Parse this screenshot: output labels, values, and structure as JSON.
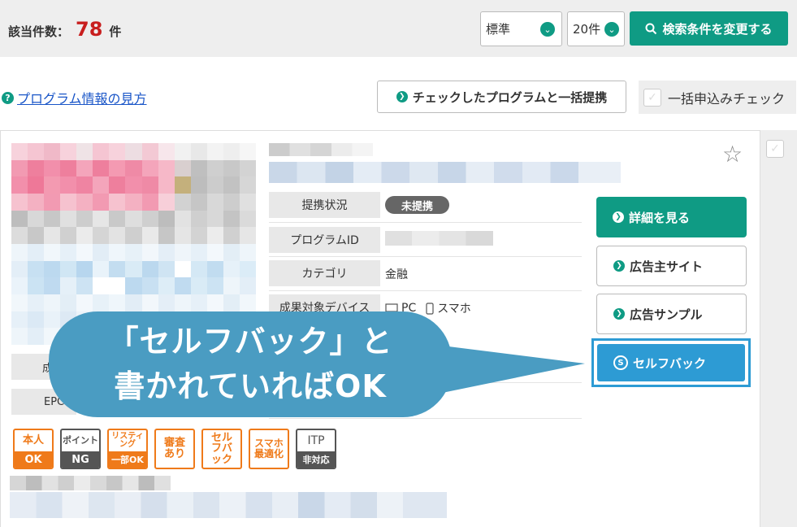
{
  "results": {
    "prefix": "該当件数：",
    "count": "78",
    "suffix": "件"
  },
  "sort_select": {
    "value": "標準"
  },
  "per_page_select": {
    "value": "20件"
  },
  "search_button": {
    "label": "検索条件を変更する"
  },
  "help_link": {
    "label": "プログラム情報の見方"
  },
  "bulk_button": {
    "label": "チェックしたプログラムと一括提携"
  },
  "bulk_check": {
    "label": "一括申込みチェック"
  },
  "program": {
    "rows": [
      {
        "label": "提携状況",
        "value": "未提携"
      },
      {
        "label": "プログラムID",
        "value": ""
      },
      {
        "label": "カテゴリ",
        "value": "金融"
      },
      {
        "label": "成果対象デバイス",
        "devices": [
          "PC",
          "スマホ"
        ]
      }
    ],
    "stats": [
      {
        "label": "成"
      },
      {
        "label": "EPC"
      }
    ],
    "buttons": {
      "details": "詳細を見る",
      "advertiser_site": "広告主サイト",
      "ad_sample": "広告サンプル",
      "selfback": "セルフバック"
    },
    "tags": [
      {
        "top": "本人",
        "bottom": "OK",
        "style": "orange"
      },
      {
        "top": "ポイント",
        "bottom": "NG",
        "style": "gray"
      },
      {
        "top": "リスティング",
        "bottom": "一部OK",
        "style": "orange"
      },
      {
        "top": "審査あり",
        "bottom": "",
        "style": "orange-full"
      },
      {
        "top": "セルフバック",
        "bottom": "",
        "style": "orange-full"
      },
      {
        "top": "スマホ最適化",
        "bottom": "",
        "style": "orange-full"
      },
      {
        "top": "ITP",
        "bottom": "非対応",
        "style": "gray"
      }
    ]
  },
  "callout": {
    "line1": "「セルフバック」と",
    "line2": "書かれていればOK"
  },
  "colors": {
    "accent": "#0f9b84",
    "count": "#c81e1e",
    "selfback": "#2d9bd4",
    "tag": "#ef7a1a",
    "callout": "#4a9cc2"
  }
}
